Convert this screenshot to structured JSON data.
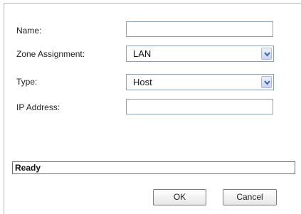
{
  "form": {
    "name_label": "Name:",
    "name_value": "",
    "zone_label": "Zone Assignment:",
    "zone_value": "LAN",
    "type_label": "Type:",
    "type_value": "Host",
    "ip_label": "IP Address:",
    "ip_value": ""
  },
  "status": {
    "text": "Ready"
  },
  "buttons": {
    "ok": "OK",
    "cancel": "Cancel"
  },
  "icons": {
    "dropdown": "chevron-down-icon"
  }
}
